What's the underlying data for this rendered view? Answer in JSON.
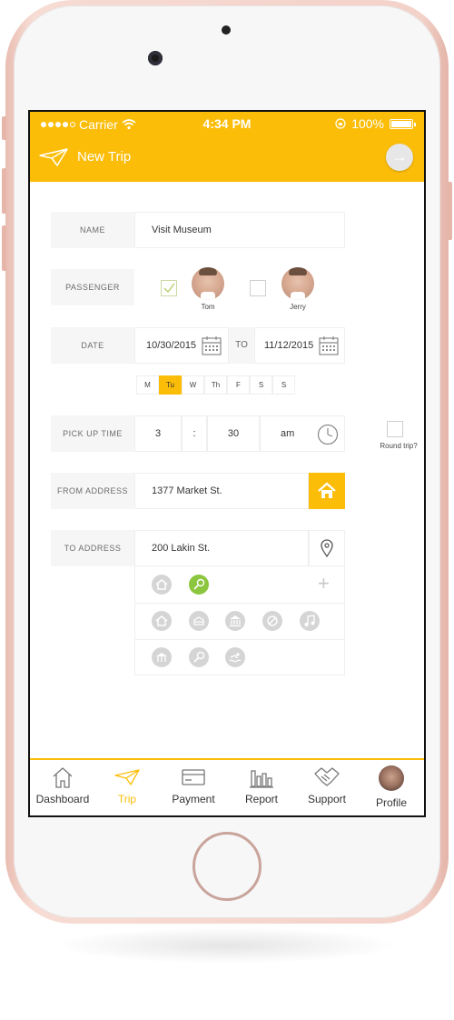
{
  "status_bar": {
    "carrier": "Carrier",
    "time": "4:34 PM",
    "battery": "100%"
  },
  "header": {
    "title": "New Trip"
  },
  "form": {
    "name": {
      "label": "NAME",
      "value": "Visit Museum"
    },
    "passenger": {
      "label": "PASSENGER",
      "people": [
        {
          "name": "Tom",
          "checked": true
        },
        {
          "name": "Jerry",
          "checked": false
        }
      ]
    },
    "date": {
      "label": "DATE",
      "from": "10/30/2015",
      "to_label": "TO",
      "to": "11/12/2015"
    },
    "weekdays": [
      "M",
      "Tu",
      "W",
      "Th",
      "F",
      "S",
      "S"
    ],
    "selected_weekday": "Tu",
    "pickup": {
      "label": "PICK UP TIME",
      "hour": "3",
      "separator": ":",
      "minute": "30",
      "period": "am"
    },
    "round_trip_label": "Round trip?",
    "from_address": {
      "label": "FROM ADDRESS",
      "value": "1377 Market St."
    },
    "to_address": {
      "label": "TO ADDRESS",
      "value": "200 Lakin St."
    },
    "selected_places": [
      "home-icon",
      "soccer-icon"
    ],
    "place_options": [
      "home-icon",
      "school-icon",
      "museum-icon",
      "baseball-icon",
      "music-icon",
      "park-icon",
      "soccer-icon",
      "swimming-icon"
    ]
  },
  "tabs": [
    {
      "label": "Dashboard",
      "icon": "house-icon",
      "active": false
    },
    {
      "label": "Trip",
      "icon": "paper-plane-icon",
      "active": true
    },
    {
      "label": "Payment",
      "icon": "credit-card-icon",
      "active": false
    },
    {
      "label": "Report",
      "icon": "bar-chart-icon",
      "active": false
    },
    {
      "label": "Support",
      "icon": "handshake-icon",
      "active": false
    },
    {
      "label": "Profile",
      "icon": "profile-photo",
      "active": false
    }
  ],
  "colors": {
    "accent": "#FBBD08",
    "green": "#8CC63F"
  }
}
